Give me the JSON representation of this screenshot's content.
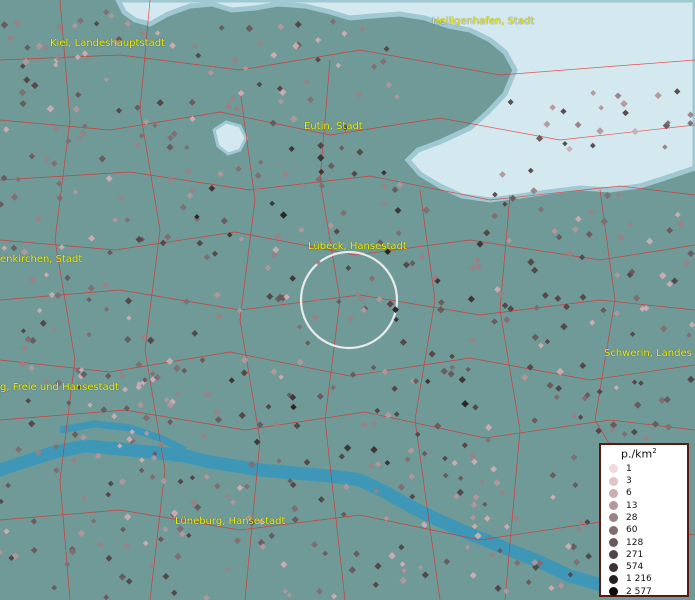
{
  "map": {
    "cities": [
      {
        "id": "kiel",
        "name": "Kiel, Landeshauptstadt"
      },
      {
        "id": "heiligenhafen",
        "name": "Heiligenhafen, Stadt"
      },
      {
        "id": "eutin",
        "name": "Eutin, Stadt"
      },
      {
        "id": "luebeck",
        "name": "Lübeck, Hansestadt"
      },
      {
        "id": "neumuenster",
        "name": "enkirchen, Stadt"
      },
      {
        "id": "hamburg",
        "name": "g, Freie und Hansestadt"
      },
      {
        "id": "schwerin",
        "name": "Schwerin, Landes"
      },
      {
        "id": "lueneburg",
        "name": "Lüneburg, Hansestadt"
      }
    ],
    "colors": {
      "land": "#6f9a97",
      "sea": "#d4e9ef",
      "river": "#3f97b8",
      "borders": "#e8231e",
      "city_label": "#f2f200",
      "focus_circle": "#f4f4f4"
    }
  },
  "legend": {
    "unit_base": "p./km",
    "unit_exp": "2",
    "entries": [
      {
        "label": "1",
        "color": "#f3d9dc"
      },
      {
        "label": "3",
        "color": "#e3c3c7"
      },
      {
        "label": "6",
        "color": "#ccadb1"
      },
      {
        "label": "13",
        "color": "#b3979b"
      },
      {
        "label": "28",
        "color": "#9a8185"
      },
      {
        "label": "60",
        "color": "#816d70"
      },
      {
        "label": "128",
        "color": "#68595b"
      },
      {
        "label": "271",
        "color": "#514547"
      },
      {
        "label": "574",
        "color": "#3b3233"
      },
      {
        "label": "1 216",
        "color": "#252021"
      },
      {
        "label": "2 577",
        "color": "#0f0c0c"
      }
    ]
  }
}
